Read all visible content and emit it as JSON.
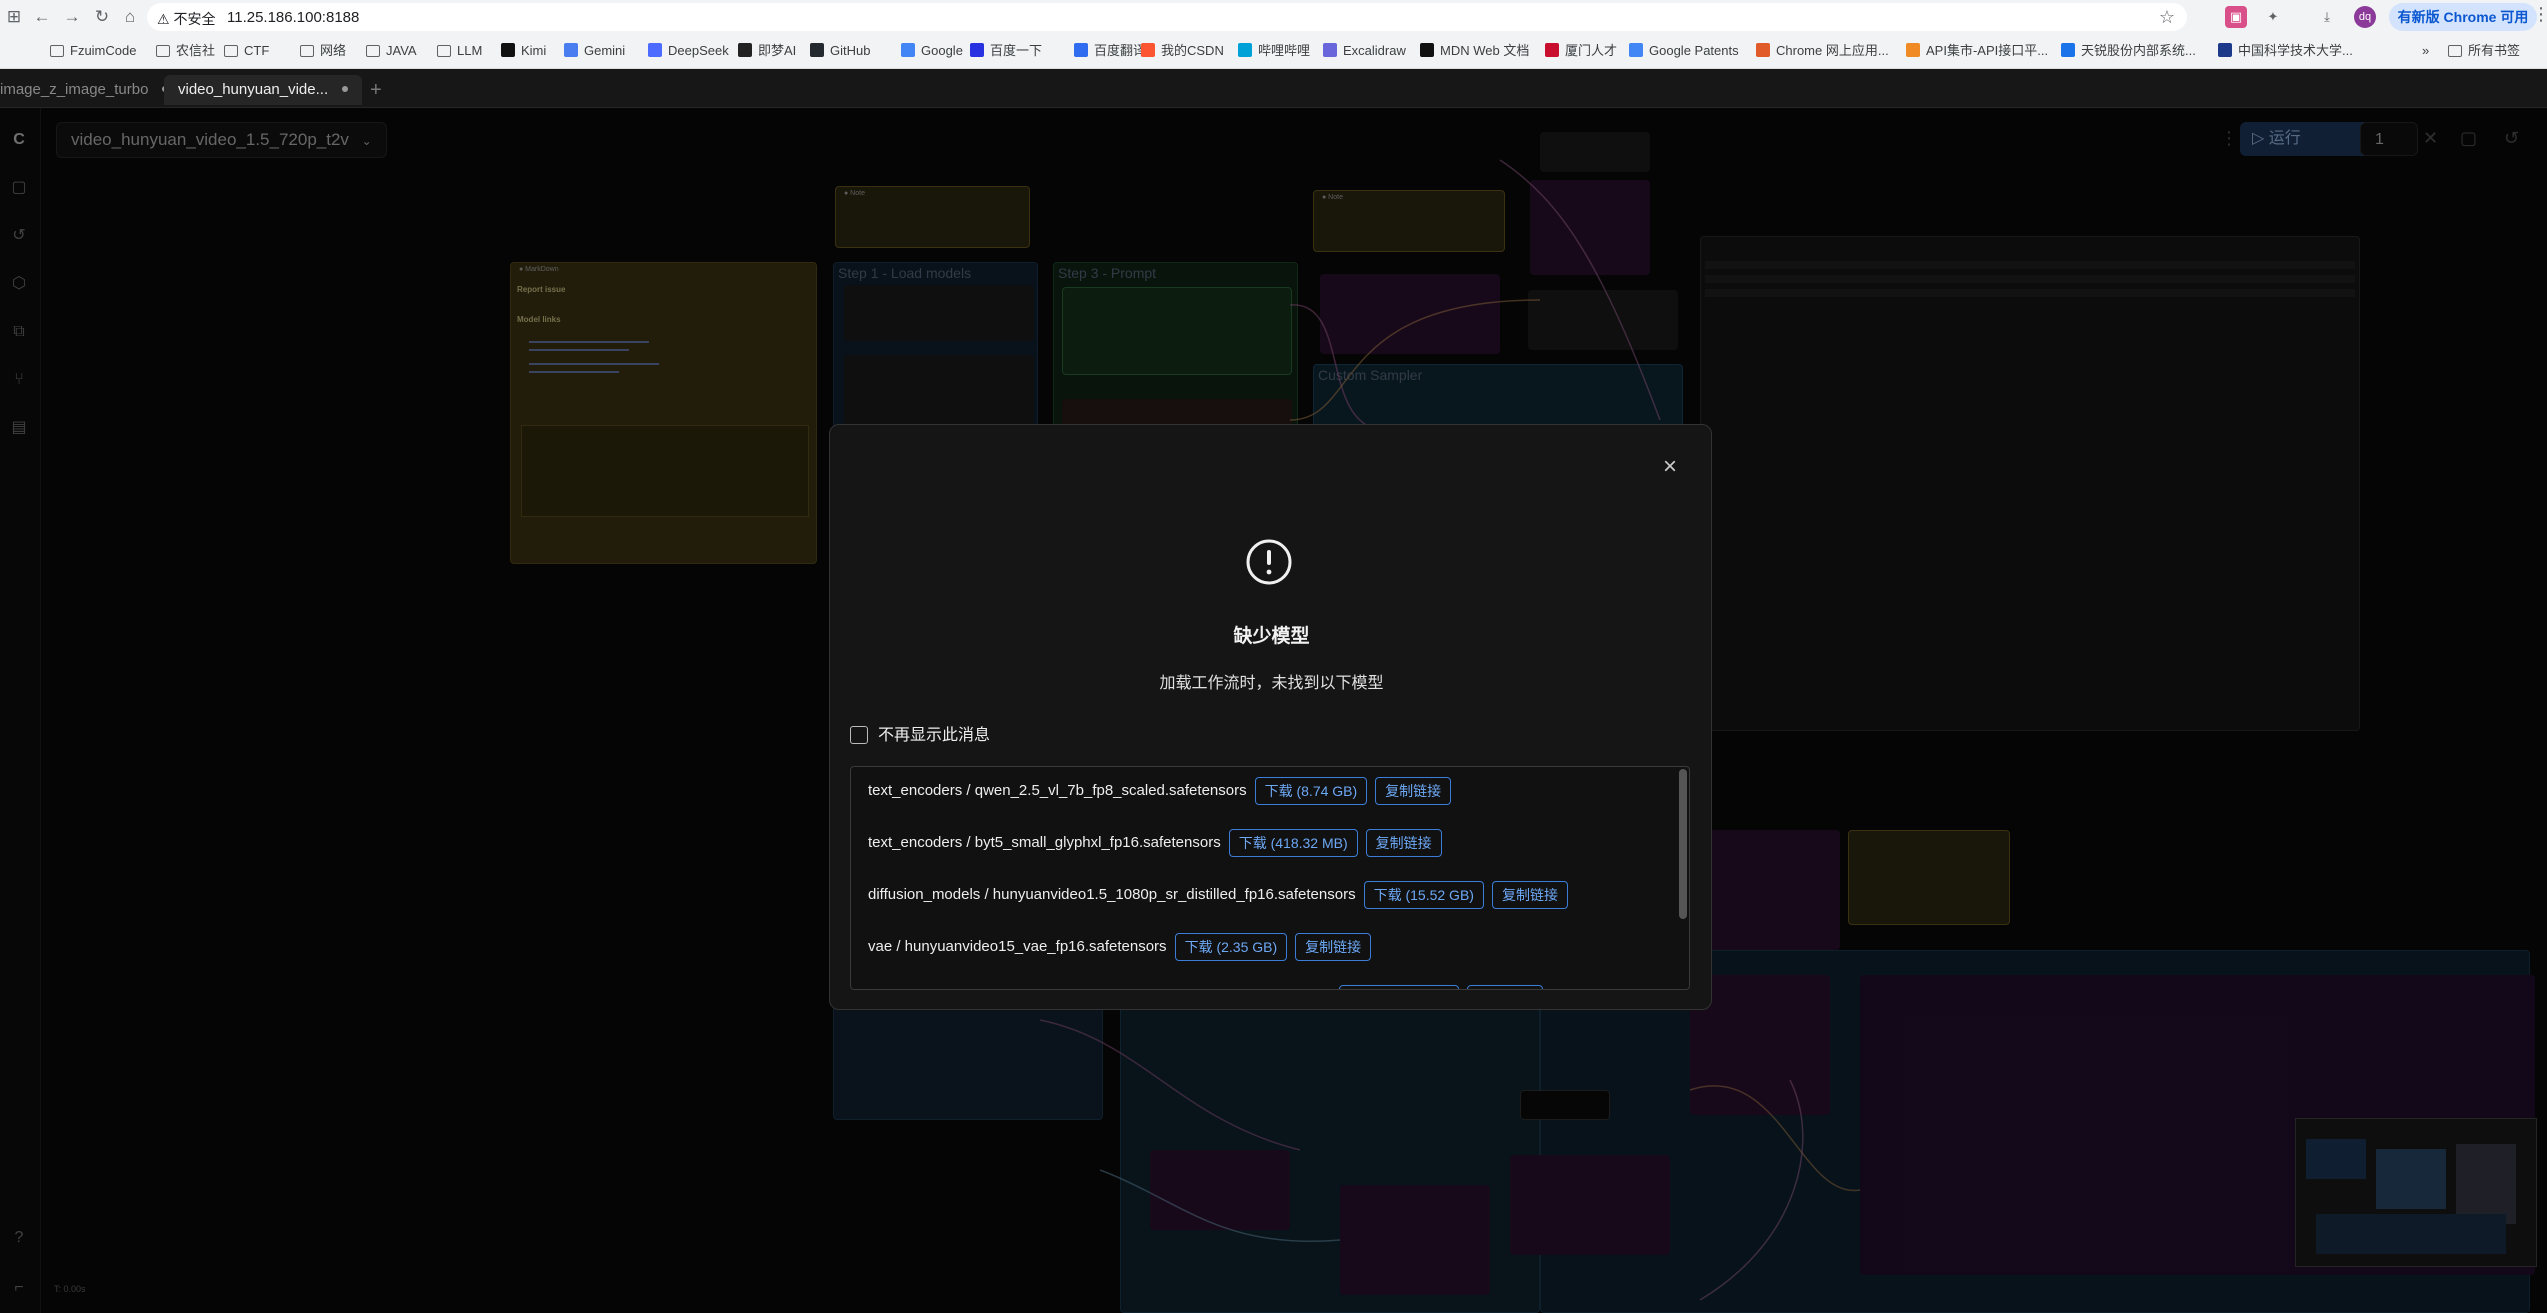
{
  "browser": {
    "security_label": "不安全",
    "url": "11.25.186.100:8188",
    "update_label": "有新版 Chrome 可用",
    "avatar_initials": "dq",
    "bookmarks": [
      {
        "label": "FzuimCode",
        "icon": "folder-icon"
      },
      {
        "label": "农信社",
        "icon": "folder-icon"
      },
      {
        "label": "CTF",
        "icon": "folder-icon"
      },
      {
        "label": "网络",
        "icon": "folder-icon"
      },
      {
        "label": "JAVA",
        "icon": "folder-icon"
      },
      {
        "label": "LLM",
        "icon": "folder-icon"
      },
      {
        "label": "Kimi",
        "icon": "kimi-icon"
      },
      {
        "label": "Gemini",
        "icon": "gemini-icon"
      },
      {
        "label": "DeepSeek",
        "icon": "deepseek-icon"
      },
      {
        "label": "即梦AI",
        "icon": "jimeng-icon"
      },
      {
        "label": "GitHub",
        "icon": "github-icon"
      },
      {
        "label": "Google",
        "icon": "google-icon"
      },
      {
        "label": "百度一下",
        "icon": "baidu-icon"
      },
      {
        "label": "百度翻译",
        "icon": "baidu-translate-icon"
      },
      {
        "label": "我的CSDN",
        "icon": "csdn-icon"
      },
      {
        "label": "哔哩哔哩",
        "icon": "bilibili-icon"
      },
      {
        "label": "Excalidraw",
        "icon": "excalidraw-icon"
      },
      {
        "label": "MDN Web 文档",
        "icon": "mdn-icon"
      },
      {
        "label": "厦门人才",
        "icon": "xiamen-icon"
      },
      {
        "label": "Google Patents",
        "icon": "google-patents-icon"
      },
      {
        "label": "Chrome 网上应用...",
        "icon": "chrome-store-icon"
      },
      {
        "label": "API集市-API接口平...",
        "icon": "api-icon"
      },
      {
        "label": "天锐股份内部系统...",
        "icon": "tianrui-icon"
      },
      {
        "label": "中国科学技术大学...",
        "icon": "ustc-icon"
      }
    ],
    "all_bookmarks_label": "所有书签"
  },
  "app": {
    "tabs": [
      {
        "label": "image_z_image_turbo"
      },
      {
        "label": "video_hunyuan_vide..."
      }
    ],
    "workflow_title": "video_hunyuan_video_1.5_720p_t2v",
    "run_label": "运行",
    "run_count": "1",
    "zoom_readout": "T: 0.00s"
  },
  "modal": {
    "title": "缺少模型",
    "subtitle": "加载工作流时，未找到以下模型",
    "dismiss_label": "不再显示此消息",
    "models": [
      {
        "path": "text_encoders / qwen_2.5_vl_7b_fp8_scaled.safetensors",
        "download": "下载 (8.74 GB)",
        "copy": "复制链接"
      },
      {
        "path": "text_encoders / byt5_small_glyphxl_fp16.safetensors",
        "download": "下载 (418.32 MB)",
        "copy": "复制链接"
      },
      {
        "path": "diffusion_models / hunyuanvideo1.5_1080p_sr_distilled_fp16.safetensors",
        "download": "下载 (15.52 GB)",
        "copy": "复制链接"
      },
      {
        "path": "vae / hunyuanvideo15_vae_fp16.safetensors",
        "download": "下载 (2.35 GB)",
        "copy": "复制链接"
      }
    ]
  },
  "canvas": {
    "groups": [
      {
        "label": "Step 1 - Load models"
      },
      {
        "label": "Step 3 - Prompt"
      },
      {
        "label": "Custom Sampler"
      }
    ],
    "note_title": "Model links",
    "report_title": "Report issue"
  },
  "colors": {
    "accent_blue": "#3b7dd8",
    "run_bg": "#1f3a5f",
    "note_yellow": "#3d3513",
    "node_purple": "#2a1230"
  }
}
